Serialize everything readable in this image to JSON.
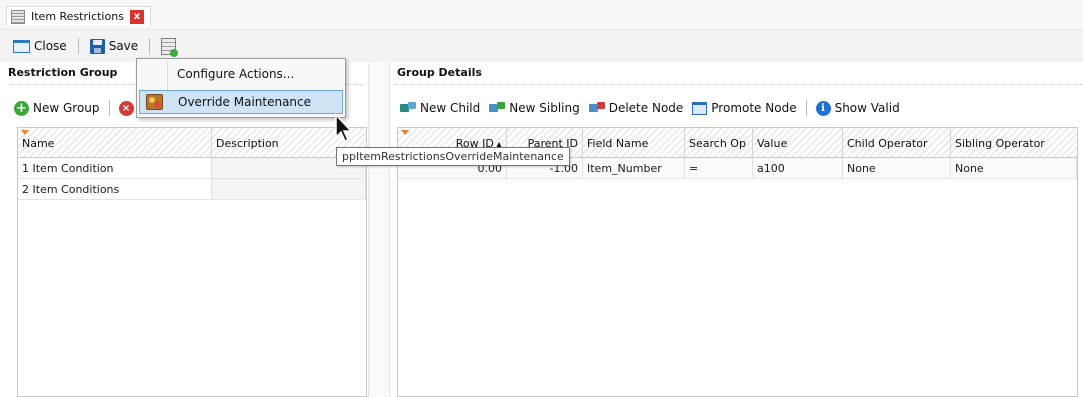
{
  "tab": {
    "title": "Item Restrictions",
    "close_glyph": "x",
    "icon": "document-list-icon"
  },
  "toolbar": {
    "close_label": "Close",
    "save_label": "Save",
    "icons": [
      "close-window-icon",
      "save-disk-icon",
      "actions-list-icon"
    ]
  },
  "restriction_group": {
    "title": "Restriction Group",
    "new_group_label": "New Group",
    "columns": [
      "Name",
      "Description"
    ],
    "rows": [
      {
        "name": "1 Item Condition",
        "description": ""
      },
      {
        "name": "2 Item Conditions",
        "description": ""
      }
    ]
  },
  "context_menu": {
    "items": [
      {
        "label": "Configure Actions..."
      },
      {
        "label": "Override Maintenance"
      }
    ]
  },
  "tooltip": {
    "text": "ppItemRestrictionsOverrideMaintenance"
  },
  "group_details": {
    "title": "Group Details",
    "buttons": {
      "new_child": "New Child",
      "new_sibling": "New Sibling",
      "delete_node": "Delete Node",
      "promote_node": "Promote Node",
      "show_valid": "Show Valid"
    },
    "columns": {
      "row_id": "Row ID",
      "parent_id": "Parent ID",
      "field_name": "Field Name",
      "search_op": "Search Op",
      "value": "Value",
      "child_operator": "Child Operator",
      "sibling_operator": "Sibling Operator"
    },
    "sort_glyph": "▲",
    "rows": [
      {
        "row_id": "0.00",
        "parent_id": "-1.00",
        "field_name": "Item_Number",
        "search_op": "=",
        "value": "a100",
        "child_operator": "None",
        "sibling_operator": "None"
      }
    ]
  },
  "colors": {
    "highlight": "#cfe3f7",
    "highlight_border": "#6fa6dd",
    "tab_close": "#d9342b",
    "filter_marker": "#e7862a"
  }
}
